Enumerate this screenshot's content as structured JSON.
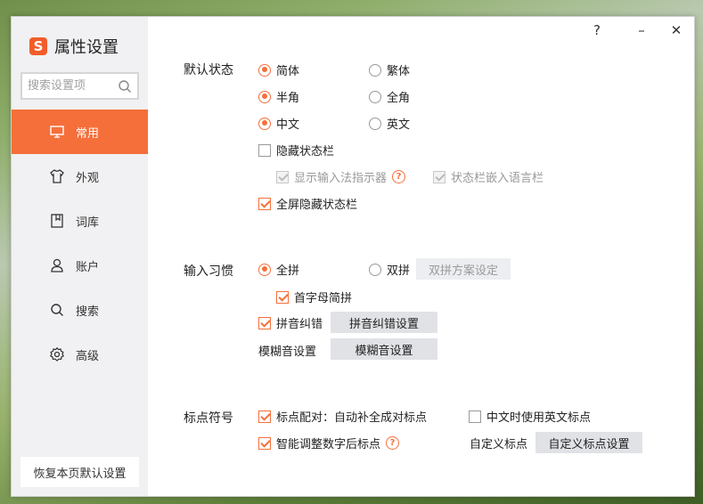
{
  "app": {
    "title": "属性设置",
    "logo_glyph": "S",
    "accent_color": "#f56f3b"
  },
  "window_controls": {
    "help": "?",
    "minimize": "–",
    "close": "✕"
  },
  "search": {
    "placeholder": "搜索设置项"
  },
  "sidebar": {
    "items": [
      {
        "label": "常用",
        "icon": "monitor-icon",
        "active": true
      },
      {
        "label": "外观",
        "icon": "shirt-icon",
        "active": false
      },
      {
        "label": "词库",
        "icon": "book-icon",
        "active": false
      },
      {
        "label": "账户",
        "icon": "user-icon",
        "active": false
      },
      {
        "label": "搜索",
        "icon": "search-icon",
        "active": false
      },
      {
        "label": "高级",
        "icon": "gear-icon",
        "active": false
      }
    ],
    "reset_label": "恢复本页默认设置"
  },
  "default_state": {
    "label": "默认状态",
    "simplified": "简体",
    "traditional": "繁体",
    "halfwidth": "半角",
    "fullwidth": "全角",
    "chinese": "中文",
    "english": "英文",
    "hide_statusbar": "隐藏状态栏",
    "show_indicator": "显示输入法指示器",
    "statusbar_embed": "状态栏嵌入语言栏",
    "fullscreen_hide": "全屏隐藏状态栏"
  },
  "input_habit": {
    "label": "输入习惯",
    "quanpin": "全拼",
    "shuangpin": "双拼",
    "shuangpin_settings": "双拼方案设定",
    "initial_abbr": "首字母简拼",
    "pinyin_correction": "拼音纠错",
    "pinyin_correction_settings": "拼音纠错设置",
    "fuzzy_label": "模糊音设置",
    "fuzzy_button": "模糊音设置"
  },
  "punctuation": {
    "label": "标点符号",
    "pairing": "标点配对：自动补全成对标点",
    "english_punct_in_chinese": "中文时使用英文标点",
    "smart_digit": "智能调整数字后标点",
    "custom_label": "自定义标点",
    "custom_button": "自定义标点设置"
  }
}
